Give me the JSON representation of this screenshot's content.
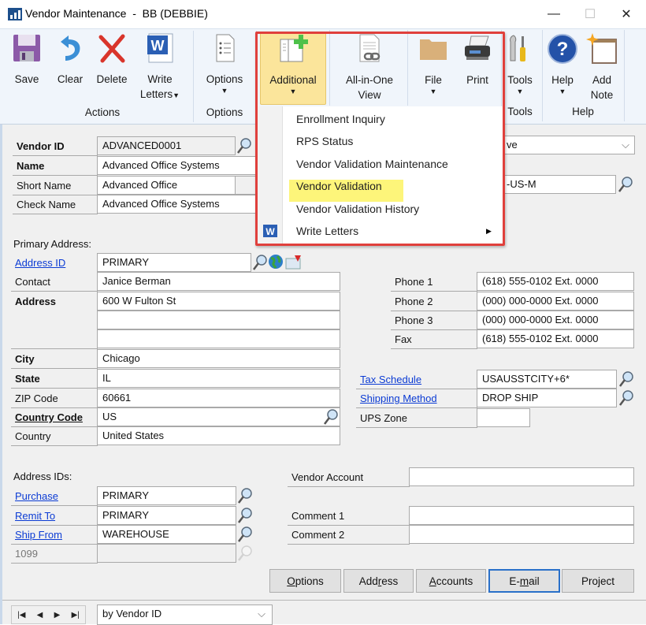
{
  "window": {
    "title": "Vendor Maintenance  -  BB (DEBBIE)",
    "controls": {
      "minimize": "—",
      "maximize": "☐",
      "close": "✕"
    }
  },
  "ribbon": {
    "groups": [
      {
        "label": "Actions",
        "buttons": [
          {
            "label": "Save",
            "icon": "save-icon"
          },
          {
            "label": "Clear",
            "icon": "undo-icon"
          },
          {
            "label": "Delete",
            "icon": "delete-icon"
          },
          {
            "label": "Write",
            "label2": "Letters",
            "icon": "word-icon",
            "dropdown": true
          }
        ]
      },
      {
        "label": "Options",
        "buttons": [
          {
            "label": "Options",
            "icon": "options-list-icon",
            "dropdown": true
          }
        ]
      },
      {
        "label": "",
        "buttons": [
          {
            "label": "Additional",
            "icon": "additional-window-icon",
            "dropdown": true,
            "active": true
          },
          {
            "label": "All-in-One",
            "label2": "View",
            "icon": "document-link-icon"
          },
          {
            "label": "File",
            "icon": "folder-icon",
            "dropdown": true
          },
          {
            "label": "Print",
            "icon": "printer-icon"
          }
        ]
      },
      {
        "label": "Tools",
        "buttons": [
          {
            "label": "Tools",
            "icon": "tools-icon",
            "dropdown": true
          }
        ]
      },
      {
        "label": "Help",
        "buttons": [
          {
            "label": "Help",
            "icon": "help-icon",
            "dropdown": true
          },
          {
            "label": "Add",
            "label2": "Note",
            "icon": "note-icon"
          }
        ]
      }
    ]
  },
  "additional_menu": {
    "items": [
      {
        "label": "Enrollment Inquiry"
      },
      {
        "label": "RPS Status"
      },
      {
        "label": "Vendor Validation Maintenance"
      },
      {
        "label": "Vendor Validation",
        "highlighted": true
      },
      {
        "label": "Vendor Validation History"
      },
      {
        "label": "Write Letters",
        "icon": "word-icon",
        "submenu": true
      }
    ],
    "highlight_color": "#fdf57a",
    "callout_color": "#e0403c"
  },
  "vendor": {
    "vendor_id_label": "Vendor ID",
    "vendor_id": "ADVANCED0001",
    "name_label": "Name",
    "name": "Advanced Office Systems",
    "short_name_label": "Short Name",
    "short_name": "Advanced Office",
    "check_name_label": "Check Name",
    "check_name": "Advanced Office Systems",
    "status_visible": "ve",
    "class_visible": "-US-M"
  },
  "primary_address": {
    "section_label": "Primary Address:",
    "address_id_label": "Address ID",
    "address_id": "PRIMARY",
    "contact_label": "Contact",
    "contact": "Janice Berman",
    "address_label": "Address",
    "address1": "600 W Fulton St",
    "address2": "",
    "address3": "",
    "city_label": "City",
    "city": "Chicago",
    "state_label": "State",
    "state": "IL",
    "zip_label": "ZIP Code",
    "zip": "60661",
    "country_code_label": "Country Code",
    "country_code": "US",
    "country_label": "Country",
    "country": "United States"
  },
  "phones": {
    "phone1_label": "Phone 1",
    "phone1": "(618) 555-0102  Ext. 0000",
    "phone2_label": "Phone 2",
    "phone2": "(000) 000-0000  Ext. 0000",
    "phone3_label": "Phone 3",
    "phone3": "(000) 000-0000  Ext. 0000",
    "fax_label": "Fax",
    "fax": "(618) 555-0102  Ext. 0000"
  },
  "shipping": {
    "tax_schedule_label": "Tax Schedule",
    "tax_schedule": "USAUSSTCITY+6*",
    "shipping_method_label": "Shipping Method",
    "shipping_method": "DROP SHIP",
    "ups_zone_label": "UPS Zone",
    "ups_zone": ""
  },
  "address_ids": {
    "section_label": "Address IDs:",
    "purchase_label": "Purchase",
    "purchase": "PRIMARY",
    "remit_to_label": "Remit To",
    "remit_to": "PRIMARY",
    "ship_from_label": "Ship From",
    "ship_from": "WAREHOUSE",
    "t1099_label": "1099",
    "t1099": ""
  },
  "other": {
    "vendor_account_label": "Vendor Account",
    "vendor_account": "",
    "comment1_label": "Comment 1",
    "comment1": "",
    "comment2_label": "Comment 2",
    "comment2": ""
  },
  "bottom_buttons": [
    {
      "pre": "",
      "u": "O",
      "post": "ptions"
    },
    {
      "pre": "Add",
      "u": "r",
      "post": "ess"
    },
    {
      "pre": "",
      "u": "A",
      "post": "ccounts"
    },
    {
      "pre": "E-",
      "u": "m",
      "post": "ail",
      "focused": true
    },
    {
      "pre": "Project",
      "u": "",
      "post": ""
    }
  ],
  "navigation": {
    "first": "|◀",
    "prev": "◀",
    "next": "▶",
    "last": "▶|",
    "sort_by": "by Vendor ID"
  }
}
